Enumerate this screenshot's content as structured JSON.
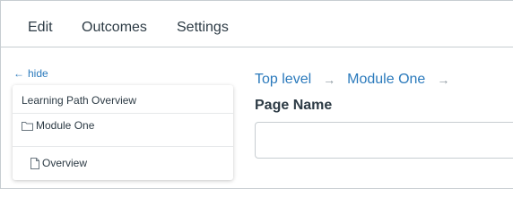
{
  "tabs": [
    {
      "label": "Edit"
    },
    {
      "label": "Outcomes"
    },
    {
      "label": "Settings"
    }
  ],
  "sidebar": {
    "hide_label": "hide",
    "hide_icon": "arrow-left-icon",
    "header": "Learning Path Overview",
    "items": [
      {
        "label": "Module One",
        "icon": "folder-icon"
      },
      {
        "label": "Overview",
        "icon": "document-icon"
      }
    ]
  },
  "breadcrumb": {
    "items": [
      "Top level",
      "Module One"
    ],
    "separator_icon": "arrow-right-icon"
  },
  "form": {
    "page_name_label": "Page Name",
    "page_name_value": ""
  },
  "colors": {
    "link": "#2b7abc",
    "text": "#2d3b45",
    "border": "#c7cdd1"
  }
}
